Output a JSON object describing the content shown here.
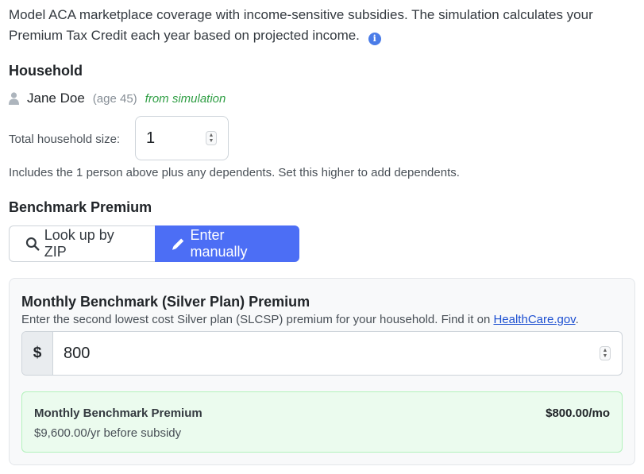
{
  "intro": {
    "text": "Model ACA marketplace coverage with income-sensitive subsidies. The simulation calculates your Premium Tax Credit each year based on projected income."
  },
  "household": {
    "title": "Household",
    "member": {
      "name": "Jane Doe",
      "age": "(age 45)",
      "source": "from simulation"
    },
    "size_label": "Total household size:",
    "size_value": "1",
    "help": "Includes the 1 person above plus any dependents. Set this higher to add dependents."
  },
  "benchmark": {
    "title": "Benchmark Premium",
    "tabs": {
      "zip": "Look up by ZIP",
      "manual": "Enter manually"
    },
    "active_tab": "manual",
    "panel": {
      "title": "Monthly Benchmark (Silver Plan) Premium",
      "desc_prefix": "Enter the second lowest cost Silver plan (SLCSP) premium for your household. Find it on ",
      "link": "HealthCare.gov",
      "desc_suffix": ".",
      "currency": "$",
      "amount": "800"
    },
    "summary": {
      "label": "Monthly Benchmark Premium",
      "value": "$800.00/mo",
      "annual": "$9,600.00/yr before subsidy"
    }
  },
  "colors": {
    "accent": "#4c6ef5",
    "success_bg": "#ebfbee",
    "success_border": "#b2f2bb",
    "source_text": "#2f9e44"
  },
  "icons": [
    "info-icon",
    "person-icon",
    "search-icon",
    "pencil-icon"
  ]
}
